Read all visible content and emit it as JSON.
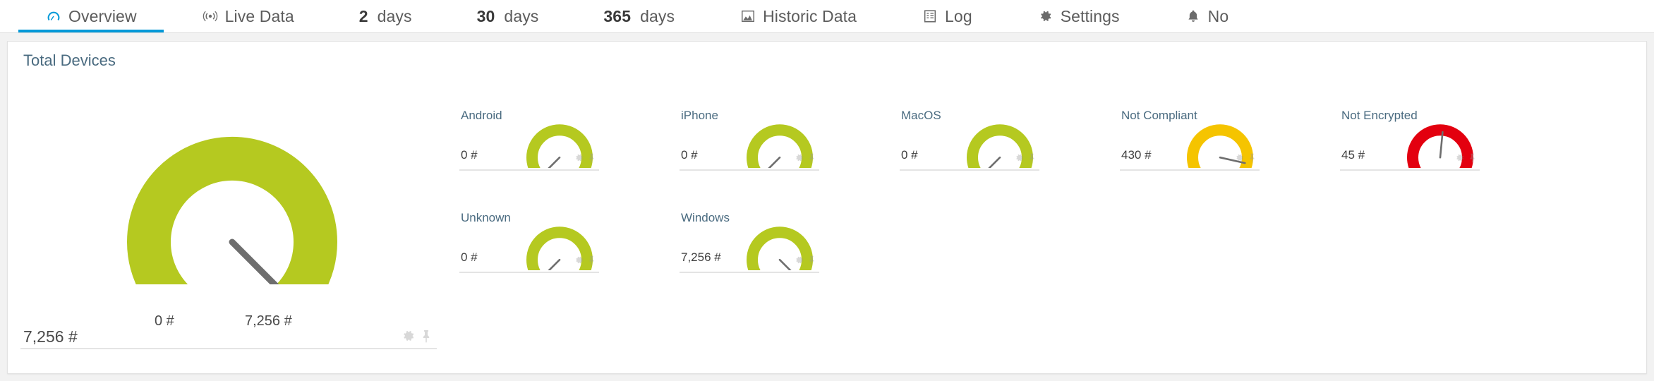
{
  "tabs": [
    {
      "label": "Overview",
      "icon": "gauge-icon",
      "active": true
    },
    {
      "label": "Live Data",
      "icon": "broadcast-icon",
      "active": false
    },
    {
      "label": "days",
      "num": "2",
      "icon": null,
      "active": false
    },
    {
      "label": "days",
      "num": "30",
      "icon": null,
      "active": false
    },
    {
      "label": "days",
      "num": "365",
      "icon": null,
      "active": false
    },
    {
      "label": "Historic Data",
      "icon": "chart-icon",
      "active": false
    },
    {
      "label": "Log",
      "icon": "list-icon",
      "active": false
    },
    {
      "label": "Settings",
      "icon": "gear-icon",
      "active": false
    },
    {
      "label": "No",
      "icon": "bell-icon",
      "active": false
    }
  ],
  "main": {
    "primary": {
      "title": "Total Devices",
      "value": "7,256 #",
      "min_label": "0 #",
      "max_label": "7,256 #"
    },
    "sensors": [
      {
        "title": "Android",
        "value": "0 #",
        "color": "#b5c920",
        "pct": 0.0
      },
      {
        "title": "iPhone",
        "value": "0 #",
        "color": "#b5c920",
        "pct": 0.0
      },
      {
        "title": "MacOS",
        "value": "0 #",
        "color": "#b5c920",
        "pct": 0.0
      },
      {
        "title": "Not Compliant",
        "value": "430 #",
        "color": "#f5c400",
        "pct": 0.88
      },
      {
        "title": "Not Encrypted",
        "value": "45 #",
        "color": "#e3000f",
        "pct": 0.52
      },
      {
        "title": "Unknown",
        "value": "0 #",
        "color": "#b5c920",
        "pct": 0.0
      },
      {
        "title": "Windows",
        "value": "7,256 #",
        "color": "#b5c920",
        "pct": 1.0
      }
    ]
  },
  "chart_data": [
    {
      "type": "gauge",
      "title": "Total Devices",
      "value": 7256,
      "unit": "#",
      "min": 0,
      "max": 7256,
      "needle_pct": 1.0,
      "arc_color": "#b5c920",
      "xlabel": "",
      "ylabel": ""
    },
    {
      "type": "gauge",
      "title": "Android",
      "value": 0,
      "unit": "#",
      "min": 0,
      "max": 7256,
      "needle_pct": 0.0,
      "arc_color": "#b5c920"
    },
    {
      "type": "gauge",
      "title": "iPhone",
      "value": 0,
      "unit": "#",
      "min": 0,
      "max": 7256,
      "needle_pct": 0.0,
      "arc_color": "#b5c920"
    },
    {
      "type": "gauge",
      "title": "MacOS",
      "value": 0,
      "unit": "#",
      "min": 0,
      "max": 7256,
      "needle_pct": 0.0,
      "arc_color": "#b5c920"
    },
    {
      "type": "gauge",
      "title": "Not Compliant",
      "value": 430,
      "unit": "#",
      "min": 0,
      "max": 500,
      "needle_pct": 0.88,
      "arc_color": "#f5c400"
    },
    {
      "type": "gauge",
      "title": "Not Encrypted",
      "value": 45,
      "unit": "#",
      "min": 0,
      "max": 100,
      "needle_pct": 0.52,
      "arc_color": "#e3000f"
    },
    {
      "type": "gauge",
      "title": "Unknown",
      "value": 0,
      "unit": "#",
      "min": 0,
      "max": 7256,
      "needle_pct": 0.0,
      "arc_color": "#b5c920"
    },
    {
      "type": "gauge",
      "title": "Windows",
      "value": 7256,
      "unit": "#",
      "min": 0,
      "max": 7256,
      "needle_pct": 1.0,
      "arc_color": "#b5c920"
    }
  ],
  "colors": {
    "accent": "#0099d8",
    "green": "#b5c920",
    "yellow": "#f5c400",
    "red": "#e3000f",
    "title": "#4a6b80"
  }
}
